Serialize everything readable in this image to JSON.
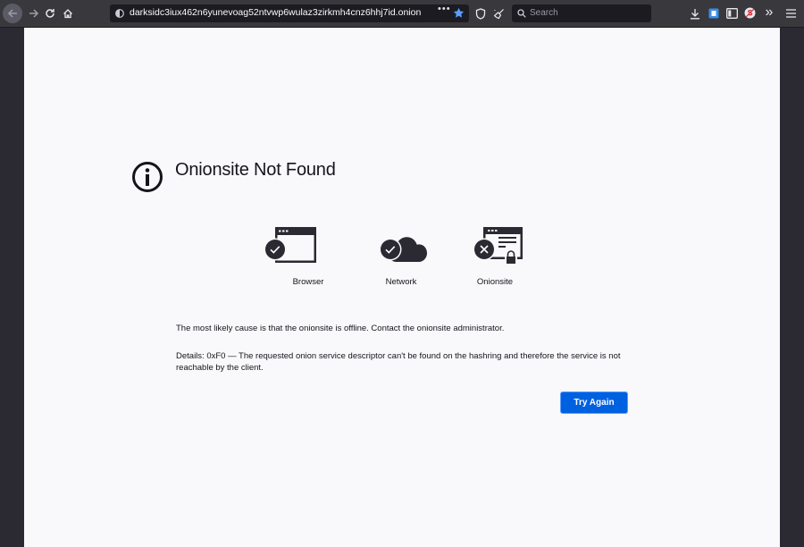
{
  "toolbar": {
    "url": "darksidc3iux462n6yunevoag52ntvwp6wulaz3zirkmh4cnz6hhj7id.onion",
    "url_more": "•••",
    "search_placeholder": "Search",
    "overflow_glyph": "»"
  },
  "error": {
    "title": "Onionsite Not Found",
    "nodes": [
      {
        "label": "Browser",
        "status": "ok"
      },
      {
        "label": "Network",
        "status": "ok"
      },
      {
        "label": "Onionsite",
        "status": "error"
      }
    ],
    "cause": "The most likely cause is that the onionsite is offline. Contact the onionsite administrator.",
    "details": "Details: 0xF0 — The requested onion service descriptor can't be found on the hashring and therefore the service is not reachable by the client.",
    "button_label": "Try Again"
  },
  "colors": {
    "accent": "#0061e0",
    "page_bg": "#f9f9fb",
    "toolbar_bg": "#38383d"
  }
}
